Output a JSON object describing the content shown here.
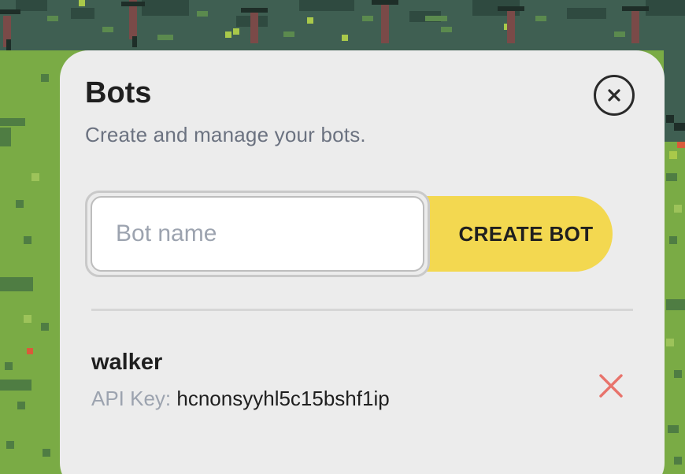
{
  "modal": {
    "title": "Bots",
    "subtitle": "Create and manage your bots."
  },
  "create_form": {
    "input_value": "",
    "input_placeholder": "Bot name",
    "create_label": "CREATE BOT"
  },
  "bots": [
    {
      "name": "walker",
      "api_key_label": "API Key:",
      "api_key": "hcnonsyyhl5c15bshf1ip"
    }
  ],
  "icons": {
    "close": "close-icon",
    "delete": "delete-x-icon"
  },
  "colors": {
    "accent": "#f3d850",
    "delete": "#e8736b",
    "grass": "#7aab45",
    "forest": "#3d5a4e",
    "modal_bg": "#ececec"
  }
}
